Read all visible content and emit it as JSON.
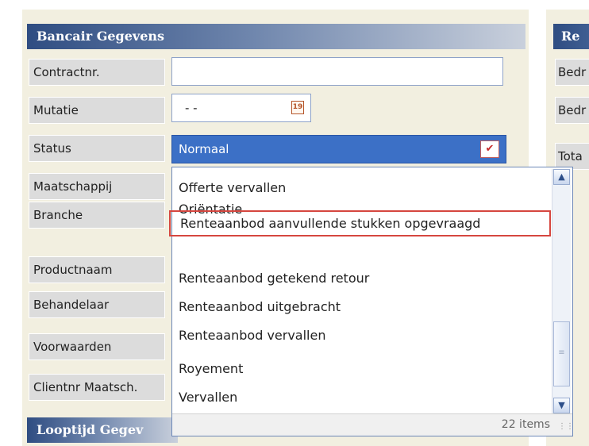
{
  "sections": {
    "bancair": "Bancair Gegevens",
    "looptijd": "Looptijd Gegev",
    "right": "Re"
  },
  "fields": {
    "contractnr": {
      "label": "Contractnr.",
      "value": ""
    },
    "mutatie": {
      "label": "Mutatie",
      "value": "- -"
    },
    "status": {
      "label": "Status",
      "value": "Normaal"
    },
    "maatschappij": {
      "label": "Maatschappij"
    },
    "branche": {
      "label": "Branche"
    },
    "productnaam": {
      "label": "Productnaam"
    },
    "behandelaar": {
      "label": "Behandelaar"
    },
    "voorwaarden": {
      "label": "Voorwaarden"
    },
    "clientnr": {
      "label": "Clientnr Maatsch."
    }
  },
  "right_labels": [
    "Bedr",
    "Bedr",
    "Tota"
  ],
  "calendar_icon_text": "19",
  "dropdown": {
    "items": [
      "Offerte vervallen",
      "Oriëntatie",
      "Renteaanbod aanvullende stukken opgevraagd",
      "Renteaanbod getekend retour",
      "Renteaanbod uitgebracht",
      "Renteaanbod vervallen",
      "Royement",
      "Vervallen"
    ],
    "highlighted_index": 2,
    "count_text": "22 items"
  },
  "icons": {
    "calendar": "calendar-icon",
    "dropdown_arrow": "chevron-down-icon",
    "scroll_up": "scroll-up-icon",
    "scroll_down": "scroll-down-icon",
    "resize": "resize-grip-icon"
  },
  "colors": {
    "header_dark": "#2f4d82",
    "select_bg": "#3c70c6",
    "highlight_border": "#d6463f",
    "form_bg": "#f2efe0",
    "label_bg": "#dcdcdc"
  }
}
